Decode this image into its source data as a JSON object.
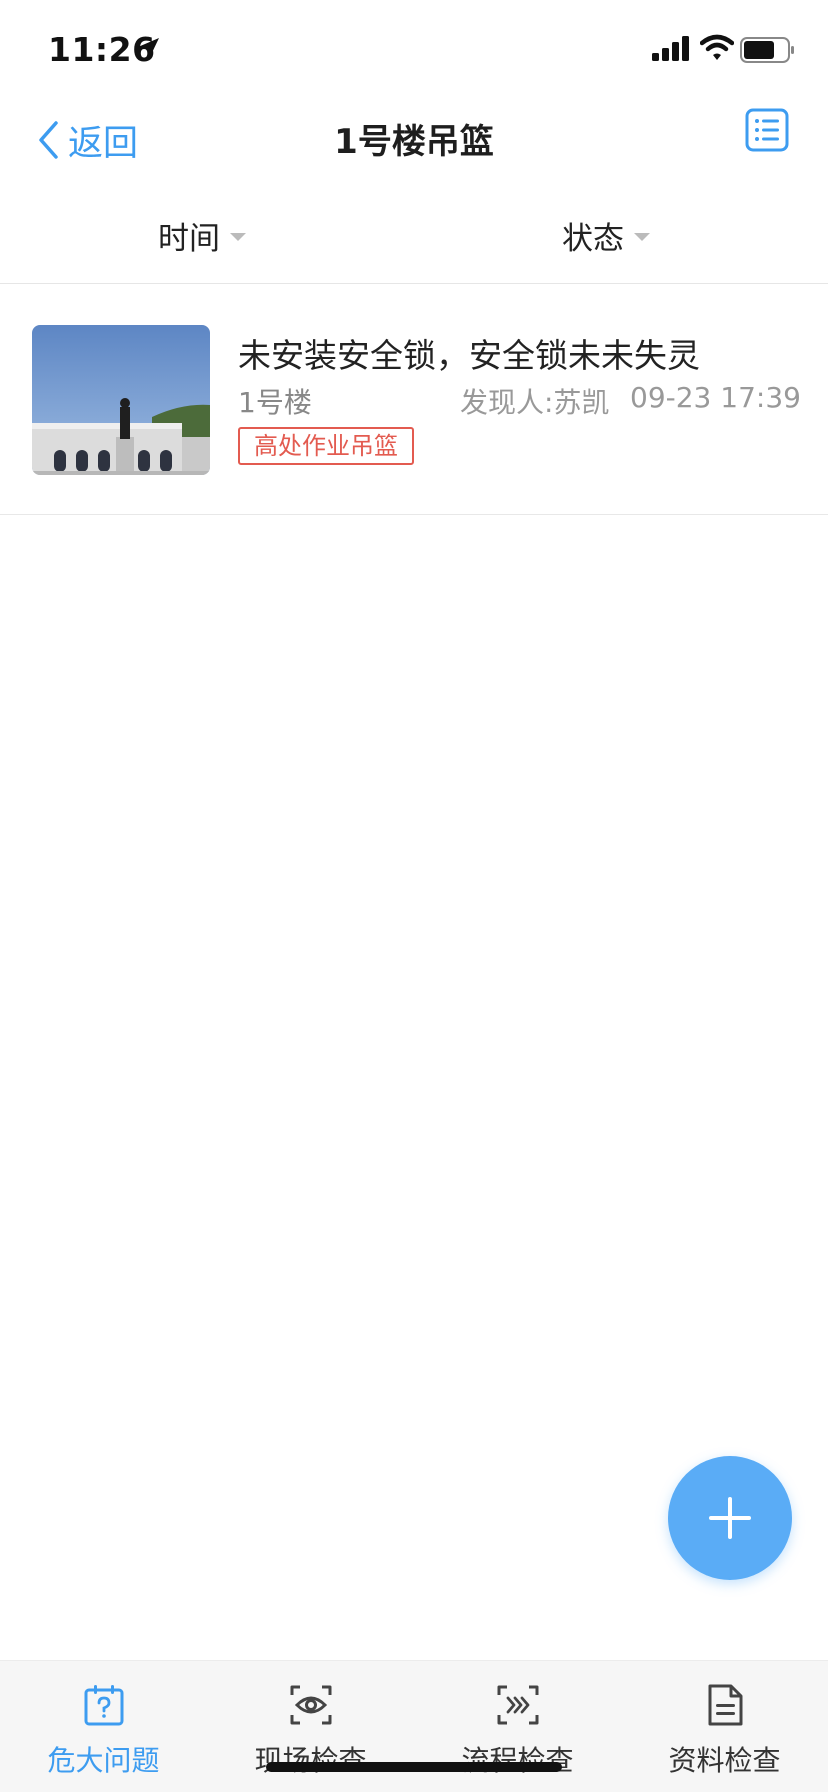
{
  "status_bar": {
    "time": "11:26"
  },
  "nav": {
    "back_label": "返回",
    "title": "1号楼吊篮"
  },
  "filters": {
    "time_label": "时间",
    "status_label": "状态"
  },
  "items": [
    {
      "title": "未安装安全锁，安全锁未未失灵",
      "building": "1号楼",
      "finder": "发现人:苏凯",
      "datetime": "09-23 17:39",
      "tag": "高处作业吊篮"
    }
  ],
  "tabs": [
    {
      "label": "危大问题",
      "icon": "calendar-question-icon",
      "active": true
    },
    {
      "label": "现场检查",
      "icon": "eye-scan-icon",
      "active": false
    },
    {
      "label": "流程检查",
      "icon": "flow-scan-icon",
      "active": false
    },
    {
      "label": "资料检查",
      "icon": "document-icon",
      "active": false
    }
  ],
  "colors": {
    "accent": "#3d9cf0",
    "fab": "#5aacf6",
    "tag": "#e35b50"
  }
}
